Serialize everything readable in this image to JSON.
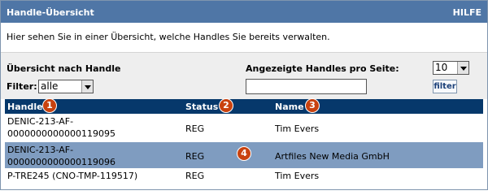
{
  "header": {
    "title": "Handle-Übersicht",
    "help": "HILFE"
  },
  "intro": "Hier sehen Sie in einer Übersicht, welche Handles Sie bereits verwalten.",
  "filter": {
    "section_label": "Übersicht nach Handle",
    "filter_label": "Filter:",
    "filter_value": "alle",
    "per_page_label": "Angezeigte Handles pro Seite:",
    "per_page_value": "10",
    "search_value": "",
    "button_label": "filter"
  },
  "table": {
    "columns": [
      "Handle",
      "Status",
      "Name"
    ],
    "rows": [
      {
        "handle_line1": "DENIC-213-AF-",
        "handle_line2": "0000000000000119095",
        "status": "REG",
        "name": "Tim Evers"
      },
      {
        "handle_line1": "DENIC-213-AF-",
        "handle_line2": "0000000000000119096",
        "status": "REG",
        "name": "Artfiles New Media GmbH"
      },
      {
        "handle_line1": "P-TRE245 (CNO-TMP-119517)",
        "handle_line2": "",
        "status": "REG",
        "name": "Tim Evers"
      }
    ]
  },
  "badges": [
    "1",
    "2",
    "3",
    "4"
  ],
  "colors": {
    "titlebar": "#4f76a6",
    "table_header": "#06386b",
    "selected_row": "#7f9cc0",
    "badge": "#c9420f"
  }
}
